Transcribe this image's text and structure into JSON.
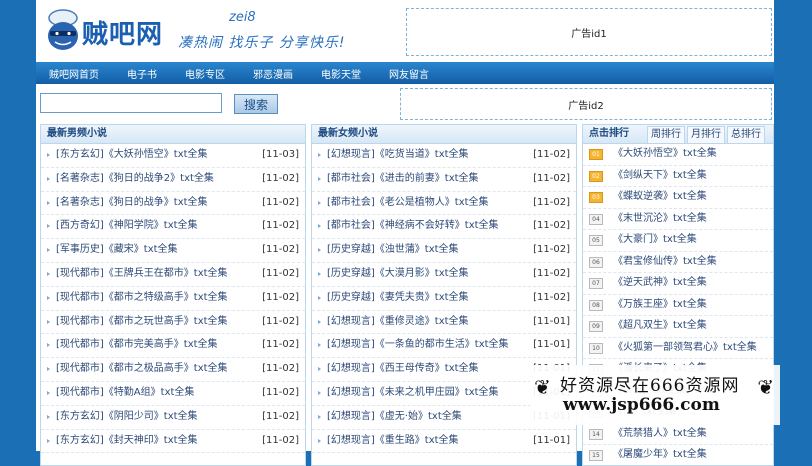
{
  "header": {
    "logo_text": "贼吧网",
    "logo_en": "zei8",
    "slogan": "凑热闹 找乐子 分享快乐!",
    "ad1": "广告id1",
    "ad2": "广告id2"
  },
  "nav": [
    "贼吧网首页",
    "电子书",
    "电影专区",
    "邪恶漫画",
    "电影天堂",
    "网友留言"
  ],
  "search": {
    "value": "",
    "button": "搜索"
  },
  "male": {
    "title": "最新男频小说",
    "items": [
      {
        "t": "[东方玄幻]《大妖孙悟空》txt全集",
        "d": "[11-03]"
      },
      {
        "t": "[名著杂志]《狗日的战争2》txt全集",
        "d": "[11-02]"
      },
      {
        "t": "[名著杂志]《狗日的战争》txt全集",
        "d": "[11-02]"
      },
      {
        "t": "[西方奇幻]《神阳学院》txt全集",
        "d": "[11-02]"
      },
      {
        "t": "[军事历史]《藏宋》txt全集",
        "d": "[11-02]"
      },
      {
        "t": "[现代都市]《王牌兵王在都市》txt全集",
        "d": "[11-02]"
      },
      {
        "t": "[现代都市]《都市之特级高手》txt全集",
        "d": "[11-02]"
      },
      {
        "t": "[现代都市]《都市之玩世高手》txt全集",
        "d": "[11-02]"
      },
      {
        "t": "[现代都市]《都市完美高手》txt全集",
        "d": "[11-02]"
      },
      {
        "t": "[现代都市]《都市之极品高手》txt全集",
        "d": "[11-02]"
      },
      {
        "t": "[现代都市]《特勤A组》txt全集",
        "d": "[11-02]"
      },
      {
        "t": "[东方玄幻]《阴阳少司》txt全集",
        "d": "[11-02]"
      },
      {
        "t": "[东方玄幻]《封天神印》txt全集",
        "d": "[11-02]"
      }
    ]
  },
  "female": {
    "title": "最新女频小说",
    "items": [
      {
        "t": "[幻想现言]《吃货当道》txt全集",
        "d": "[11-02]"
      },
      {
        "t": "[都市社会]《进击的前妻》txt全集",
        "d": "[11-02]"
      },
      {
        "t": "[都市社会]《老公是植物人》txt全集",
        "d": "[11-02]"
      },
      {
        "t": "[都市社会]《神经病不会好转》txt全集",
        "d": "[11-02]"
      },
      {
        "t": "[历史穿越]《浊世蒲》txt全集",
        "d": "[11-02]"
      },
      {
        "t": "[历史穿越]《大漠月影》txt全集",
        "d": "[11-02]"
      },
      {
        "t": "[历史穿越]《妻凭夫贵》txt全集",
        "d": "[11-02]"
      },
      {
        "t": "[幻想现言]《重修灵途》txt全集",
        "d": "[11-01]"
      },
      {
        "t": "[幻想现言]《一条鱼的都市生活》txt全集",
        "d": "[11-01]"
      },
      {
        "t": "[幻想现言]《西王母传奇》txt全集",
        "d": "[11-01]"
      },
      {
        "t": "[幻想现言]《未来之机甲庄园》txt全集",
        "d": "[11-01]"
      },
      {
        "t": "[幻想现言]《虚无·始》txt全集",
        "d": "[11-01]"
      },
      {
        "t": "[幻想现言]《重生路》txt全集",
        "d": "[11-01]"
      }
    ]
  },
  "ranking": {
    "title": "点击排行",
    "tabs": [
      "周排行",
      "月排行",
      "总排行"
    ],
    "items": [
      {
        "n": "01",
        "t": "《大妖孙悟空》txt全集"
      },
      {
        "n": "02",
        "t": "《剑纵天下》txt全集"
      },
      {
        "n": "03",
        "t": "《蝶蚁逆袭》txt全集"
      },
      {
        "n": "04",
        "t": "《末世沉沦》txt全集"
      },
      {
        "n": "05",
        "t": "《大豪门》txt全集"
      },
      {
        "n": "06",
        "t": "《君宝修仙传》txt全集"
      },
      {
        "n": "07",
        "t": "《逆天武神》txt全集"
      },
      {
        "n": "08",
        "t": "《万族王座》txt全集"
      },
      {
        "n": "09",
        "t": "《超凡双生》txt全集"
      },
      {
        "n": "10",
        "t": "《火狐第一部领驾君心》txt全集"
      },
      {
        "n": "11",
        "t": "《潘长来了》txt全集"
      },
      {
        "n": "12",
        "t": "《......》txt全集"
      },
      {
        "n": "13",
        "t": "《...》txt全集"
      },
      {
        "n": "14",
        "t": "《荒禁猎人》txt全集"
      },
      {
        "n": "15",
        "t": "《屠魔少年》txt全集"
      }
    ]
  },
  "watermark": {
    "line1": "好资源尽在666资源网",
    "line2": "www.jsp666.com"
  },
  "colors": {
    "brand": "#1a6fb5",
    "nav": "#1c6db8",
    "rank_top": "#f5b530"
  }
}
